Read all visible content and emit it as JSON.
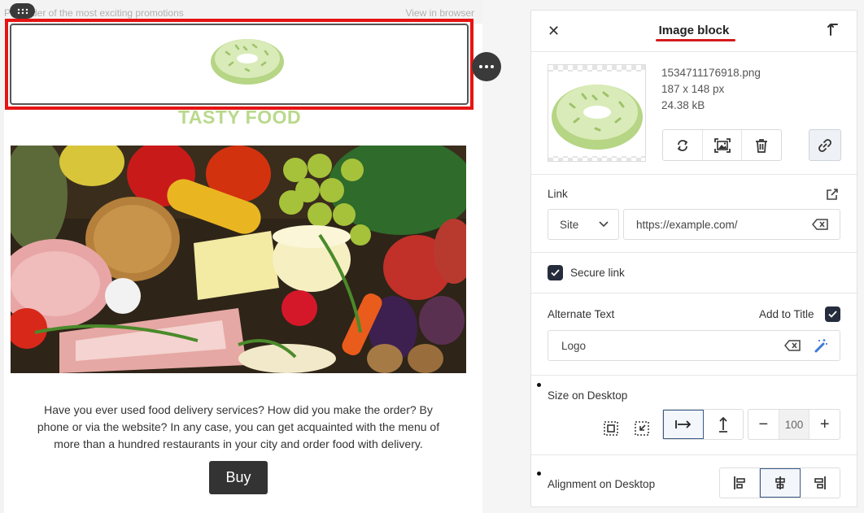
{
  "email": {
    "preheader": "P… order of the most exciting promotions",
    "view_in_browser": "View in browser",
    "logo_title": "TASTY FOOD",
    "body_text": "Have you ever used food delivery services? How did you make the order? By phone or via the website? In any case, you can get acquainted with the menu of more than a hundred restaurants in your city and order food with delivery.",
    "buy_label": "Buy"
  },
  "panel": {
    "title": "Image block",
    "file": {
      "name": "1534711176918.png",
      "dimensions": "187 x 148 px",
      "size": "24.38 kB"
    },
    "link": {
      "label": "Link",
      "type_value": "Site",
      "url_placeholder": "https://example.com/"
    },
    "secure_link": {
      "label": "Secure link",
      "checked": true
    },
    "alt_text": {
      "label": "Alternate Text",
      "add_to_title_label": "Add to Title",
      "add_to_title_checked": true,
      "value": "Logo"
    },
    "size": {
      "label": "Size on Desktop",
      "value": "100",
      "minus": "−",
      "plus": "+"
    },
    "alignment": {
      "label": "Alignment on Desktop",
      "options": [
        "align-left",
        "align-center",
        "align-right"
      ],
      "selected": "align-center"
    }
  },
  "colors": {
    "selection_border": "#e61414",
    "logo_green": "#b9d98b",
    "checkbox": "#252c3c",
    "title_underline": "#d41b1b"
  },
  "icons": [
    "close-icon",
    "upload-arrow-icon",
    "replace-icon",
    "crop-icon",
    "trash-icon",
    "link-icon",
    "external-link-icon",
    "chevron-down-icon",
    "clear-icon",
    "magic-wand-icon",
    "shrink-icon",
    "expand-icon",
    "fit-width-icon",
    "fit-height-icon"
  ]
}
